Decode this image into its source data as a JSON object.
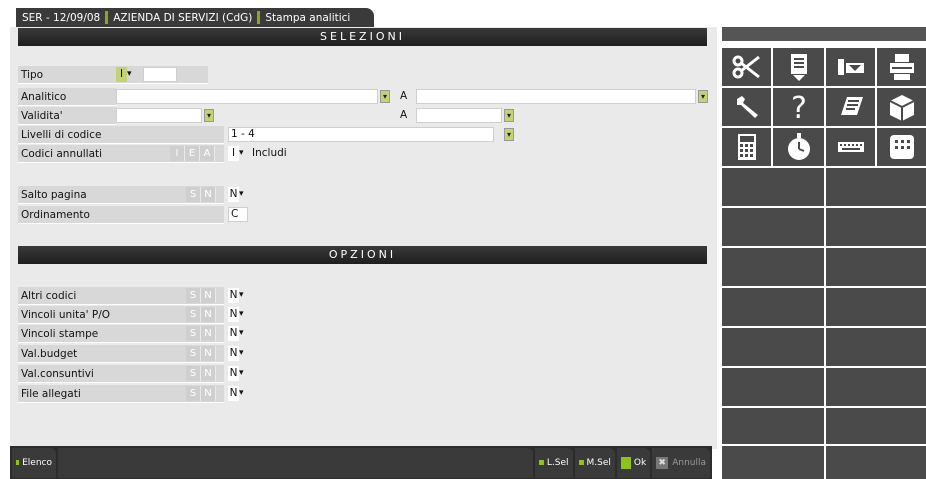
{
  "tabbar": {
    "crumbs": [
      "SER - 12/09/08",
      "AZIENDA DI SERVIZI (CdG)",
      "Stampa analitici"
    ]
  },
  "sections": {
    "selezioni": "SELEZIONI",
    "opzioni": "OPZIONI"
  },
  "fields": {
    "tipo": {
      "label": "Tipo",
      "value": "I",
      "extra": ""
    },
    "analitico": {
      "label": "Analitico",
      "from": "",
      "to_label": "A",
      "to": ""
    },
    "validita": {
      "label": "Validita'",
      "from": "",
      "to_label": "A",
      "to": ""
    },
    "livelli": {
      "label": "Livelli di codice",
      "value": "1 - 4"
    },
    "codici_annullati": {
      "label": "Codici annullati",
      "opts": [
        "I",
        "E",
        "A"
      ],
      "value": "I",
      "suffix": "Includi"
    },
    "salto_pagina": {
      "label": "Salto pagina",
      "opts": [
        "S",
        "N"
      ],
      "value": "N"
    },
    "ordinamento": {
      "label": "Ordinamento",
      "value": "C"
    }
  },
  "options": [
    {
      "label": "Altri codici",
      "opts": [
        "S",
        "N"
      ],
      "value": "N"
    },
    {
      "label": "Vincoli unita' P/O",
      "opts": [
        "S",
        "N"
      ],
      "value": "N"
    },
    {
      "label": "Vincoli stampe",
      "opts": [
        "S",
        "N"
      ],
      "value": "N"
    },
    {
      "label": "Val.budget",
      "opts": [
        "S",
        "N"
      ],
      "value": "N"
    },
    {
      "label": "Val.consuntivi",
      "opts": [
        "S",
        "N"
      ],
      "value": "N"
    },
    {
      "label": "File allegati",
      "opts": [
        "S",
        "N"
      ],
      "value": "N"
    }
  ],
  "buttons": {
    "elenco": "Elenco",
    "lsel": "L.Sel",
    "msel": "M.Sel",
    "ok": "Ok",
    "annulla": "Annulla"
  },
  "toolbar_icons": [
    "scissors-icon",
    "paste-icon",
    "printer-tray-icon",
    "printer-icon",
    "wrench-icon",
    "help-icon",
    "notepad-icon",
    "box-icon",
    "calculator-icon",
    "stopwatch-icon",
    "keyboard-icon",
    "grid-icon"
  ],
  "colors": {
    "accent": "#8ec31e",
    "dropdown": "#c4d276",
    "dark": "#2c2c2c"
  }
}
